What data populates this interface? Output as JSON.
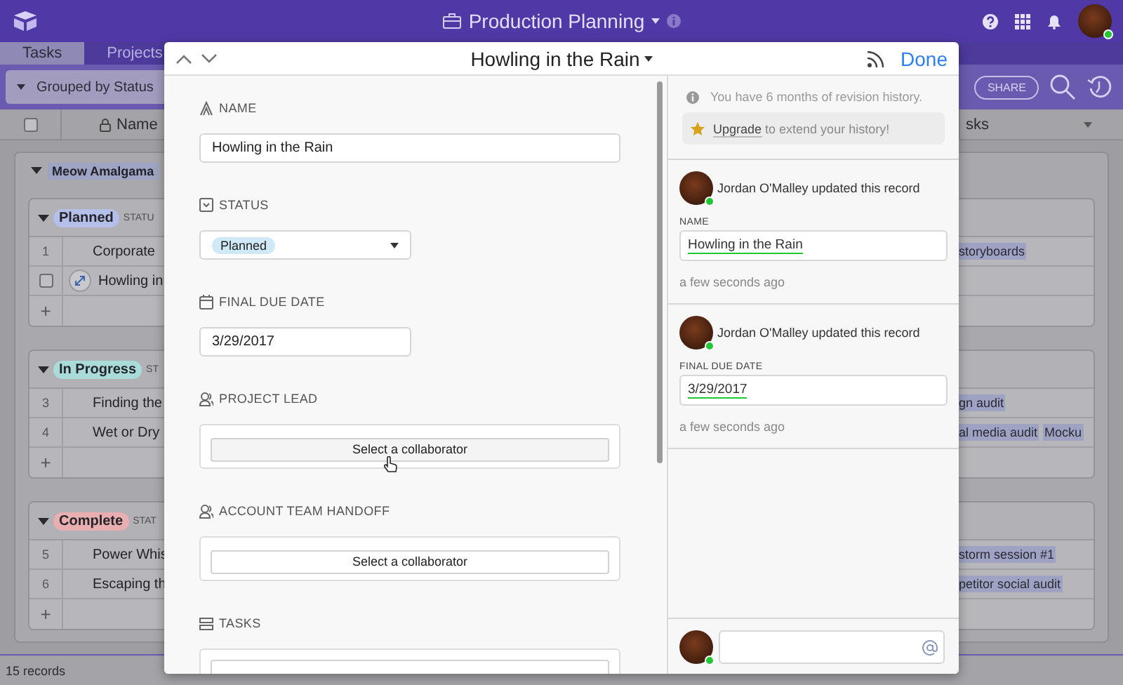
{
  "app_bar": {
    "title": "Production Planning",
    "user_online": true
  },
  "tabs": [
    {
      "label": "Tasks",
      "selected": true
    },
    {
      "label": "Projects",
      "selected": false
    }
  ],
  "toolbar": {
    "group_button": "Grouped by Status",
    "share_button": "SHARE"
  },
  "columns": {
    "select_all_checked": false,
    "column_1": "Name",
    "column_2": "sks"
  },
  "outer_group": {
    "label": "Meow Amalgama"
  },
  "groups": [
    {
      "label": "Planned",
      "color": "#b4c0ea",
      "field_label": "STATU",
      "add_button": "+",
      "rows": [
        {
          "kind": "number",
          "number": "1",
          "name": "Corporate",
          "tasks": [
            "storyboards"
          ]
        },
        {
          "kind": "hover",
          "checked": false,
          "name": "Howling in",
          "tasks": []
        }
      ]
    },
    {
      "label": "In Progress",
      "color": "#a9dcd8",
      "field_label": "ST",
      "add_button": "+",
      "rows": [
        {
          "kind": "number",
          "number": "3",
          "name": "Finding the",
          "tasks": [
            "gn audit"
          ]
        },
        {
          "kind": "number",
          "number": "4",
          "name": "Wet or Dry",
          "tasks": [
            "al media audit",
            "Mocku"
          ]
        }
      ]
    },
    {
      "label": "Complete",
      "color": "#e8aeb0",
      "field_label": "STAT",
      "add_button": "+",
      "rows": [
        {
          "kind": "number",
          "number": "5",
          "name": "Power Whis",
          "tasks": [
            "storm session #1"
          ]
        },
        {
          "kind": "number",
          "number": "6",
          "name": "Escaping th",
          "tasks": [
            "petitor social audit"
          ]
        }
      ]
    }
  ],
  "status_bar": "15 records",
  "record": {
    "title": "Howling in the Rain",
    "done": "Done",
    "fields": [
      {
        "kind": "text",
        "label": "NAME",
        "value": "Howling in the Rain"
      },
      {
        "kind": "select",
        "label": "STATUS",
        "value": "Planned"
      },
      {
        "kind": "date",
        "label": "FINAL DUE DATE",
        "value": "3/29/2017"
      },
      {
        "kind": "collaborator",
        "label": "PROJECT LEAD",
        "button": "Select a collaborator"
      },
      {
        "kind": "collaborator",
        "label": "ACCOUNT TEAM HANDOFF",
        "button": "Select a collaborator"
      },
      {
        "kind": "link",
        "label": "TASKS"
      }
    ]
  },
  "history": {
    "notice": "You have 6 months of revision history.",
    "upgrade_link": "Upgrade",
    "upgrade_text": "to extend your history!",
    "entries": [
      {
        "text": "Jordan O'Malley updated this record",
        "online": true,
        "field": "NAME",
        "value": "Howling in the Rain",
        "time": "a few seconds ago"
      },
      {
        "text": "Jordan O'Malley updated this record",
        "online": true,
        "field": "FINAL DUE DATE",
        "value": "3/29/2017",
        "time": "a few seconds ago"
      }
    ]
  },
  "comment": {
    "online": true
  }
}
